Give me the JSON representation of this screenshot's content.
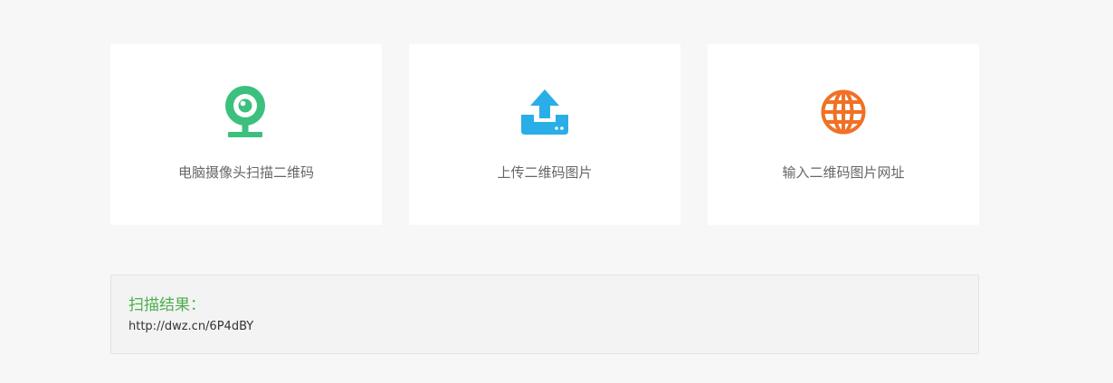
{
  "options": [
    {
      "label": "电脑摄像头扫描二维码",
      "icon": "webcam-icon",
      "color": "#3cc07d"
    },
    {
      "label": "上传二维码图片",
      "icon": "upload-icon",
      "color": "#2aaee8"
    },
    {
      "label": "输入二维码图片网址",
      "icon": "globe-icon",
      "color": "#f07126"
    }
  ],
  "result": {
    "title": "扫描结果：",
    "value": "http://dwz.cn/6P4dBY",
    "title_color": "#4cae4c"
  }
}
